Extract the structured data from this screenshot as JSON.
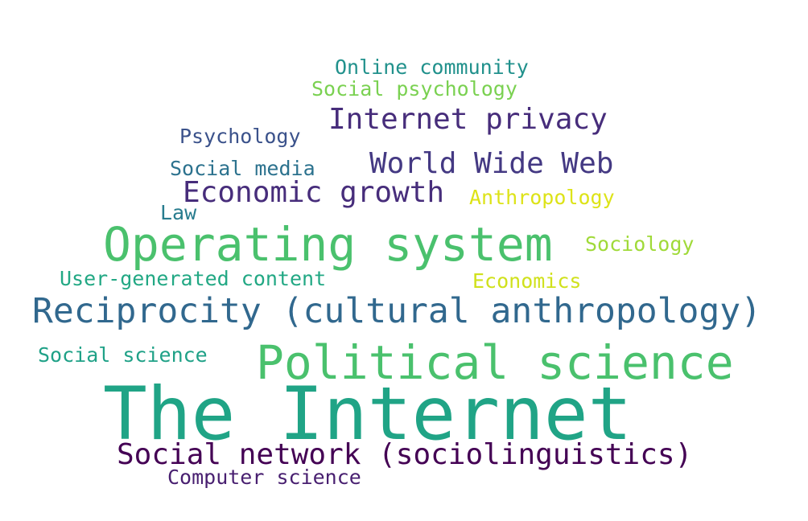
{
  "words": [
    {
      "id": "online-community",
      "text": "Online community",
      "color": "#21918c"
    },
    {
      "id": "social-psychology",
      "text": "Social psychology",
      "color": "#7ad151"
    },
    {
      "id": "internet-privacy",
      "text": "Internet privacy",
      "color": "#472d7b"
    },
    {
      "id": "psychology",
      "text": "Psychology",
      "color": "#3b528b"
    },
    {
      "id": "world-wide-web",
      "text": "World Wide Web",
      "color": "#443983"
    },
    {
      "id": "social-media",
      "text": "Social media",
      "color": "#2c728e"
    },
    {
      "id": "economic-growth",
      "text": "Economic growth",
      "color": "#472d7b"
    },
    {
      "id": "anthropology",
      "text": "Anthropology",
      "color": "#dde318"
    },
    {
      "id": "law",
      "text": "Law",
      "color": "#287c8e"
    },
    {
      "id": "operating-system",
      "text": "Operating system",
      "color": "#4ac16d"
    },
    {
      "id": "sociology",
      "text": "Sociology",
      "color": "#a0da39"
    },
    {
      "id": "user-generated-content",
      "text": "User-generated content",
      "color": "#22a884"
    },
    {
      "id": "economics",
      "text": "Economics",
      "color": "#d0e11c"
    },
    {
      "id": "reciprocity",
      "text": "Reciprocity (cultural anthropology)",
      "color": "#31688e"
    },
    {
      "id": "social-science",
      "text": "Social science",
      "color": "#1fa187"
    },
    {
      "id": "political-science",
      "text": "Political science",
      "color": "#4ac16d"
    },
    {
      "id": "the-internet",
      "text": "The Internet",
      "color": "#20a486"
    },
    {
      "id": "social-network",
      "text": "Social network (sociolinguistics)",
      "color": "#440154"
    },
    {
      "id": "computer-science",
      "text": "Computer science",
      "color": "#481f70"
    }
  ]
}
